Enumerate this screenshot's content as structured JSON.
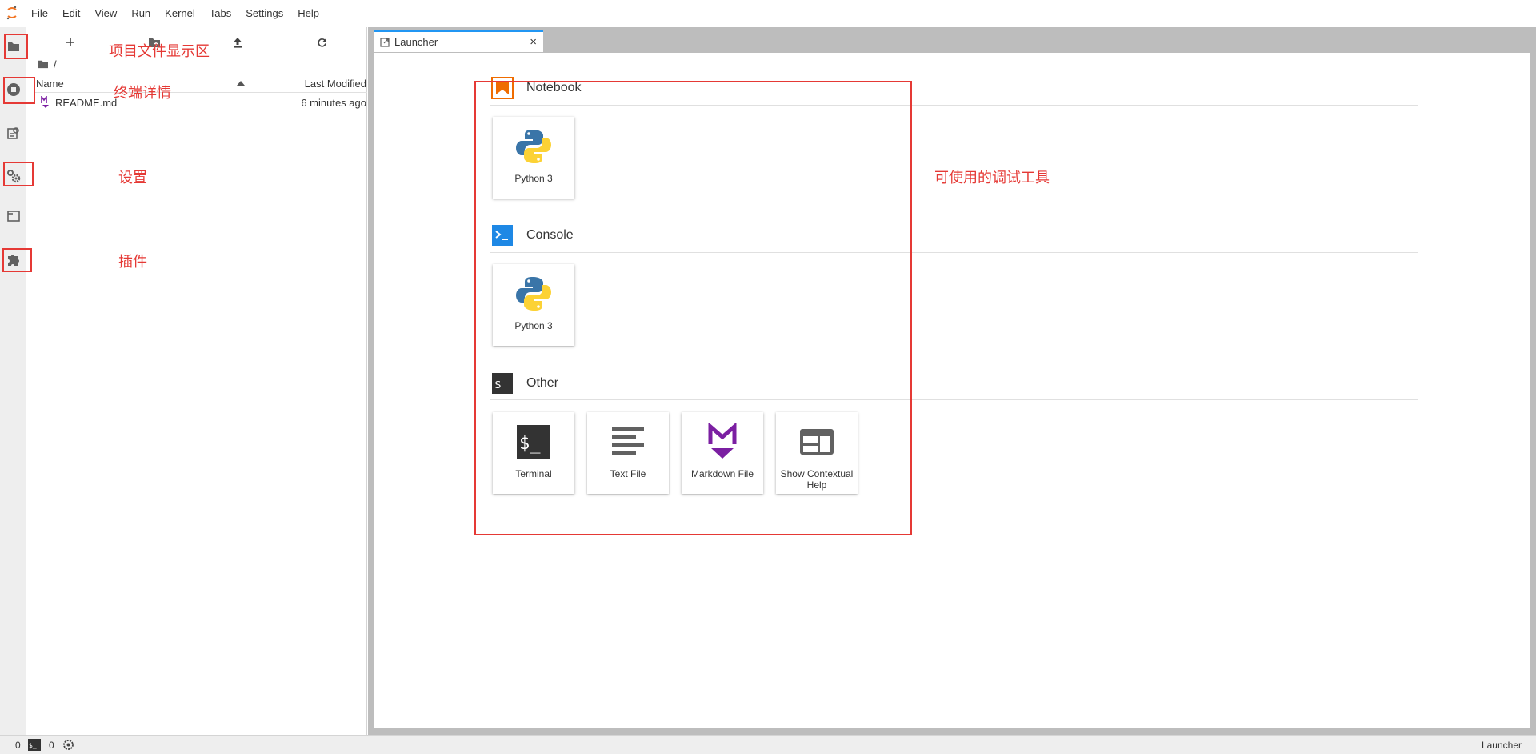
{
  "menu": [
    "File",
    "Edit",
    "View",
    "Run",
    "Kernel",
    "Tabs",
    "Settings",
    "Help"
  ],
  "file_browser": {
    "breadcrumb": "/",
    "columns": {
      "name": "Name",
      "last_modified": "Last Modified"
    },
    "files": [
      {
        "name": "README.md",
        "modified": "6 minutes ago",
        "icon": "markdown-icon"
      }
    ]
  },
  "tab": {
    "label": "Launcher",
    "close": "×"
  },
  "launcher": {
    "sections": [
      {
        "title": "Notebook",
        "cards": [
          {
            "label": "Python 3",
            "icon": "python-icon"
          }
        ]
      },
      {
        "title": "Console",
        "cards": [
          {
            "label": "Python 3",
            "icon": "python-icon"
          }
        ]
      },
      {
        "title": "Other",
        "cards": [
          {
            "label": "Terminal",
            "icon": "terminal-icon"
          },
          {
            "label": "Text File",
            "icon": "text-file-icon"
          },
          {
            "label": "Markdown File",
            "icon": "markdown-icon"
          },
          {
            "label": "Show Contextual Help",
            "icon": "contextual-help-icon"
          }
        ]
      }
    ]
  },
  "annotations": {
    "project_files": "项目文件显示区",
    "terminal_details": "终端详情",
    "settings": "设置",
    "plugins": "插件",
    "debug_tools": "可使用的调试工具"
  },
  "status": {
    "kernels": "0",
    "terminals": "0",
    "mode": "Launcher"
  },
  "colors": {
    "accent": "#2196f3",
    "annotation": "#e53935",
    "notebook": "#ef6c00",
    "console": "#1e88e5",
    "markdown": "#7b1fa2"
  }
}
